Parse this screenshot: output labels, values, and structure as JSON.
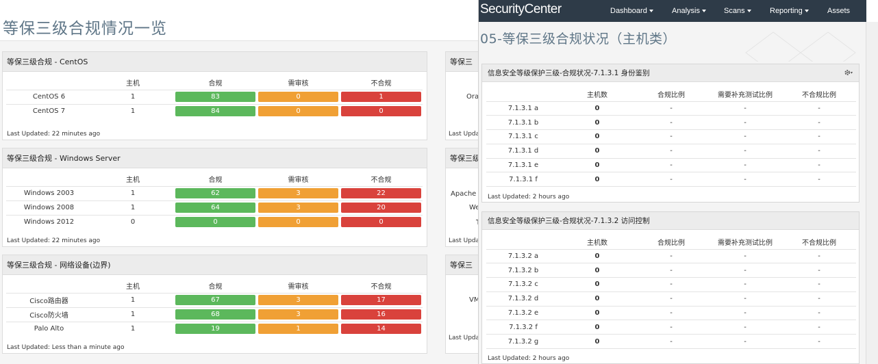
{
  "dashboard": {
    "title": "等保三级合规情况一览",
    "panels": [
      {
        "title": "等保三级合规 - CentOS",
        "columns": [
          "主机",
          "合规",
          "需审核",
          "不合规"
        ],
        "rows": [
          {
            "name": "CentOS 6",
            "host": "1",
            "compliant": "83",
            "review": "0",
            "noncompliant": "1"
          },
          {
            "name": "CentOS 7",
            "host": "1",
            "compliant": "84",
            "review": "0",
            "noncompliant": "0"
          }
        ],
        "updated": "Last Updated: 22 minutes ago"
      },
      {
        "title": "等保三级合规 - Windows Server",
        "columns": [
          "主机",
          "合规",
          "需审核",
          "不合规"
        ],
        "rows": [
          {
            "name": "Windows 2003",
            "host": "1",
            "compliant": "62",
            "review": "3",
            "noncompliant": "22"
          },
          {
            "name": "Windows 2008",
            "host": "1",
            "compliant": "64",
            "review": "3",
            "noncompliant": "20"
          },
          {
            "name": "Windows 2012",
            "host": "0",
            "compliant": "0",
            "review": "0",
            "noncompliant": "0"
          }
        ],
        "updated": "Last Updated: 22 minutes ago"
      },
      {
        "title": "等保三级合规 - 网络设备(边界)",
        "columns": [
          "主机",
          "合规",
          "需审核",
          "不合规"
        ],
        "rows": [
          {
            "name": "Cisco路由器",
            "host": "1",
            "compliant": "67",
            "review": "3",
            "noncompliant": "17"
          },
          {
            "name": "Cisco防火墙",
            "host": "1",
            "compliant": "68",
            "review": "3",
            "noncompliant": "16"
          },
          {
            "name": "Palo Alto",
            "host": "1",
            "compliant": "19",
            "review": "1",
            "noncompliant": "14"
          }
        ],
        "updated": "Last Updated: Less than a minute ago"
      }
    ],
    "peek": {
      "head1": "等保三",
      "head2": "等保三级",
      "head3": "等保三",
      "row1": "Ora",
      "upd1": "Last Updat",
      "row2a": "Apache",
      "row2b": "We",
      "row2c": "T",
      "upd2": "Last Updat",
      "row3": "VM",
      "upd3": "Last Updat"
    },
    "colors": {
      "green": "#5cb85c",
      "orange": "#f0a035",
      "red": "#d9423c"
    }
  },
  "securitycenter": {
    "logo": "SecurityCenter",
    "nav": [
      "Dashboard",
      "Analysis",
      "Scans",
      "Reporting",
      "Assets"
    ],
    "page_title": "05-等保三级合规状况（主机类）",
    "panels": [
      {
        "title": "信息安全等级保护三级-合规状况-7.1.3.1 身份鉴别",
        "columns": [
          "",
          "主机数",
          "合规比例",
          "需要补充测试比例",
          "不合规比例"
        ],
        "rows": [
          {
            "name": "7.1.3.1 a",
            "hosts": "0",
            "compliant": "-",
            "supplement": "-",
            "noncompliant": "-"
          },
          {
            "name": "7.1.3.1 b",
            "hosts": "0",
            "compliant": "-",
            "supplement": "-",
            "noncompliant": "-"
          },
          {
            "name": "7.1.3.1 c",
            "hosts": "0",
            "compliant": "-",
            "supplement": "-",
            "noncompliant": "-"
          },
          {
            "name": "7.1.3.1 d",
            "hosts": "0",
            "compliant": "-",
            "supplement": "-",
            "noncompliant": "-"
          },
          {
            "name": "7.1.3.1 e",
            "hosts": "0",
            "compliant": "-",
            "supplement": "-",
            "noncompliant": "-"
          },
          {
            "name": "7.1.3.1 f",
            "hosts": "0",
            "compliant": "-",
            "supplement": "-",
            "noncompliant": "-"
          }
        ],
        "updated": "Last Updated: 2 hours ago"
      },
      {
        "title": "信息安全等级保护三级-合规状况-7.1.3.2 访问控制",
        "columns": [
          "",
          "主机数",
          "合规比例",
          "需要补充测试比例",
          "不合规比例"
        ],
        "rows": [
          {
            "name": "7.1.3.2 a",
            "hosts": "0",
            "compliant": "-",
            "supplement": "-",
            "noncompliant": "-"
          },
          {
            "name": "7.1.3.2 b",
            "hosts": "0",
            "compliant": "-",
            "supplement": "-",
            "noncompliant": "-"
          },
          {
            "name": "7.1.3.2 c",
            "hosts": "0",
            "compliant": "-",
            "supplement": "-",
            "noncompliant": "-"
          },
          {
            "name": "7.1.3.2 d",
            "hosts": "0",
            "compliant": "-",
            "supplement": "-",
            "noncompliant": "-"
          },
          {
            "name": "7.1.3.2 e",
            "hosts": "0",
            "compliant": "-",
            "supplement": "-",
            "noncompliant": "-"
          },
          {
            "name": "7.1.3.2 f",
            "hosts": "0",
            "compliant": "-",
            "supplement": "-",
            "noncompliant": "-"
          },
          {
            "name": "7.1.3.2 g",
            "hosts": "0",
            "compliant": "-",
            "supplement": "-",
            "noncompliant": "-"
          }
        ],
        "updated": "Last Updated: 2 hours ago"
      }
    ],
    "icons": {
      "panel_menu": "gear-icon",
      "nav_caret": "chevron-down-icon"
    },
    "colors": {
      "nav_bg": "#2e3b48"
    }
  }
}
